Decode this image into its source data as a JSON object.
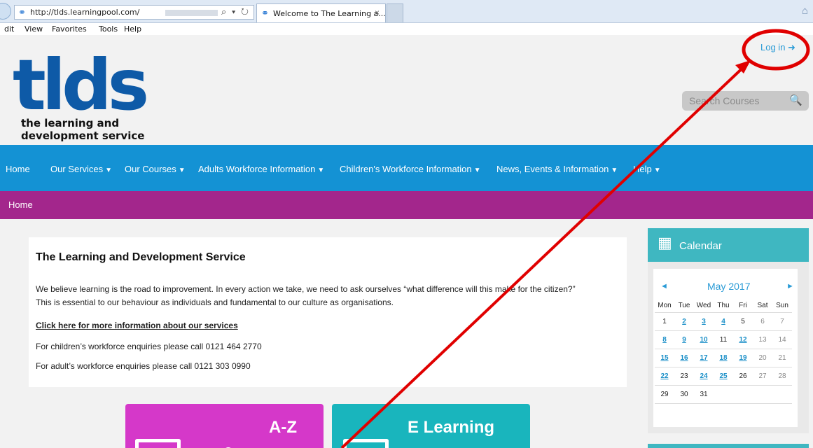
{
  "browser": {
    "url": "http://tlds.learningpool.com/",
    "tab_title": "Welcome to The Learning a...",
    "tab_close": "×",
    "menu": [
      "dit",
      "View",
      "Favorites",
      "Tools",
      "Help"
    ],
    "url_controls": "⌕ ▾ ↻"
  },
  "header": {
    "login_label": "Log in",
    "logo_text": "tlds",
    "logo_sub_1": "the learning and",
    "logo_sub_2": "development service",
    "search_placeholder": "Search Courses"
  },
  "nav": {
    "items": [
      {
        "label": "Home"
      },
      {
        "label": "Our Services"
      },
      {
        "label": "Our Courses"
      },
      {
        "label": "Adults Workforce Information"
      },
      {
        "label": "Children's Workforce Information"
      },
      {
        "label": "News, Events & Information"
      },
      {
        "label": "Help"
      }
    ],
    "breadcrumb": "Home"
  },
  "content": {
    "title": "The Learning and Development Service",
    "para1": "We believe learning is the road to improvement. In every action we take, we need to ask ourselves “what difference will this make for the citizen?”",
    "para2": "This is essential to our behaviour as individuals and fundamental to our culture as organisations.",
    "link": "Click here for more information about our services",
    "children_phone": "For children’s workforce enquiries please call 0121 464 2770",
    "adult_phone": "For adult’s workforce enquiries please call 0121 303 0990"
  },
  "tiles": [
    {
      "label": "A-Z",
      "color": "#d538c9"
    },
    {
      "label": "E Learning",
      "color": "#19b5bd"
    }
  ],
  "calendar": {
    "title": "Calendar",
    "month": "May 2017",
    "prev": "◄",
    "next": "►",
    "weekdays": [
      "Mon",
      "Tue",
      "Wed",
      "Thu",
      "Fri",
      "Sat",
      "Sun"
    ],
    "weeks": [
      [
        "1",
        "2",
        "3",
        "4",
        "5",
        "6",
        "7"
      ],
      [
        "8",
        "9",
        "10",
        "11",
        "12",
        "13",
        "14"
      ],
      [
        "15",
        "16",
        "17",
        "18",
        "19",
        "20",
        "21"
      ],
      [
        "22",
        "23",
        "24",
        "25",
        "26",
        "27",
        "28"
      ],
      [
        "29",
        "30",
        "31",
        "",
        "",
        "",
        ""
      ]
    ],
    "event_days": [
      "2",
      "3",
      "4",
      "8",
      "9",
      "10",
      "12",
      "15",
      "16",
      "17",
      "18",
      "19",
      "22",
      "24",
      "25"
    ]
  },
  "colors": {
    "nav": "#1492d4",
    "breadcrumb_bar": "#a3268c",
    "calendar_header": "#3fb7c1",
    "annotation": "#e00000"
  }
}
